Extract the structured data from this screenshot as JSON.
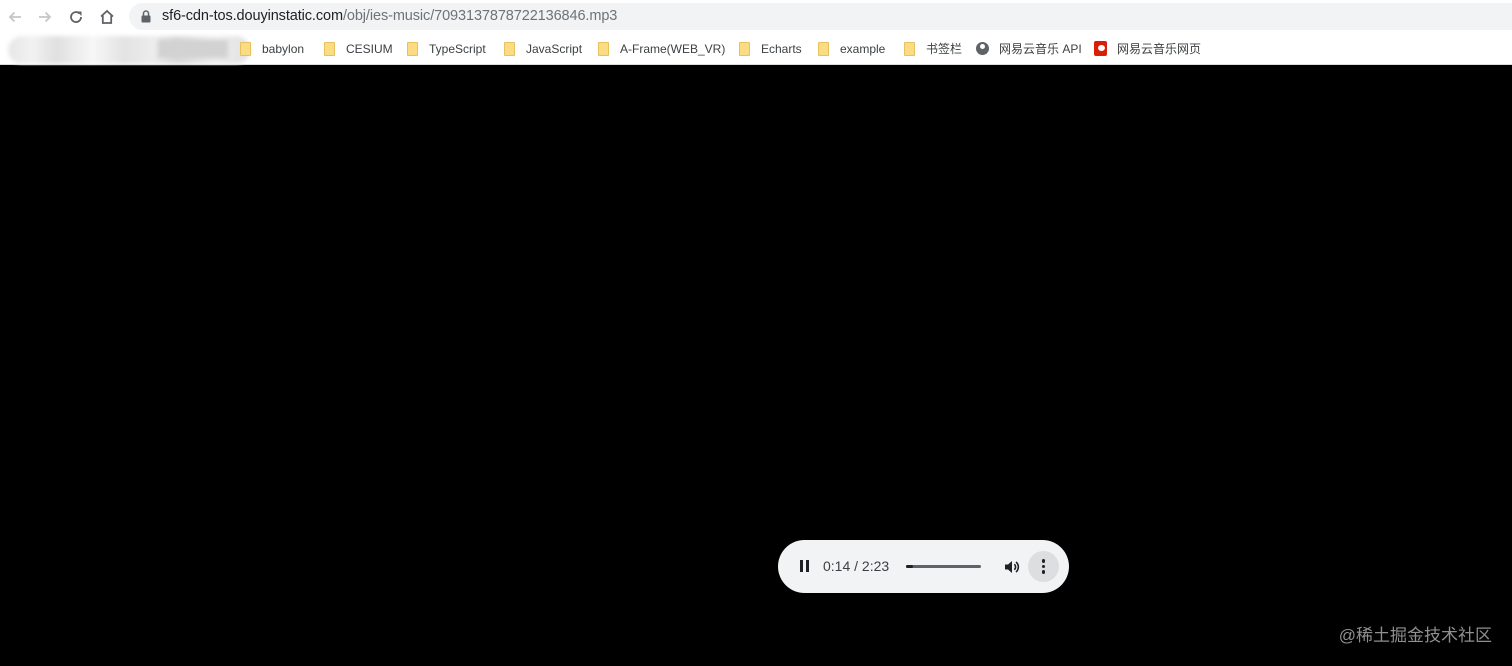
{
  "toolbar": {
    "back_icon": "back-arrow-icon",
    "forward_icon": "forward-arrow-icon",
    "reload_icon": "reload-icon",
    "home_icon": "home-icon",
    "lock_icon": "lock-icon",
    "url_host": "sf6-cdn-tos.douyinstatic.com",
    "url_path": "/obj/ies-music/7093137878722136846.mp3"
  },
  "bookmarks": [
    {
      "label": "babylon",
      "icon": "folder-icon"
    },
    {
      "label": "CESIUM",
      "icon": "folder-icon"
    },
    {
      "label": "TypeScript",
      "icon": "folder-icon"
    },
    {
      "label": "JavaScript",
      "icon": "folder-icon"
    },
    {
      "label": "A-Frame(WEB_VR)",
      "icon": "folder-icon"
    },
    {
      "label": "Echarts",
      "icon": "folder-icon"
    },
    {
      "label": "example",
      "icon": "folder-icon"
    },
    {
      "label": "书签栏",
      "icon": "folder-icon"
    },
    {
      "label": "网易云音乐 API",
      "icon": "globe-icon"
    },
    {
      "label": "网易云音乐网页",
      "icon": "netease-music-icon"
    }
  ],
  "player": {
    "state": "playing",
    "current_time": "0:14",
    "separator": "/",
    "duration": "2:23",
    "progress": 0.098,
    "time_display": "0:14 / 2:23",
    "pause_icon": "pause-icon",
    "volume_icon": "volume-icon",
    "menu_icon": "more-vertical-icon"
  },
  "watermark": "@稀土掘金技术社区",
  "colors": {
    "page_background": "#000000",
    "player_background": "#f1f3f4",
    "folder_color": "#fbdc83",
    "netease_red": "#d81e06"
  }
}
